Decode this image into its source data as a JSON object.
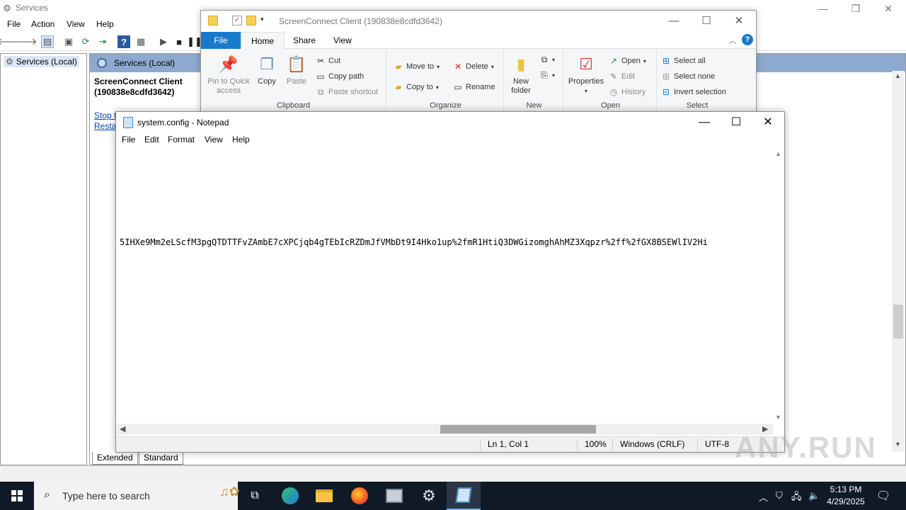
{
  "services": {
    "title": "Services",
    "menu": [
      "File",
      "Action",
      "View",
      "Help"
    ],
    "tree_item": "Services (Local)",
    "header": "Services (Local)",
    "selected_service": "ScreenConnect Client (190838e8cdfd3642)",
    "link_stop": "Stop",
    "link_stop_suffix": "t",
    "link_restart": "Restar",
    "tabs": [
      "Extended",
      "Standard"
    ]
  },
  "explorer": {
    "title": "ScreenConnect Client (190838e8cdfd3642)",
    "tabs": [
      "File",
      "Home",
      "Share",
      "View"
    ],
    "groups": {
      "clipboard": {
        "name": "Clipboard",
        "pin": "Pin to Quick access",
        "copy": "Copy",
        "paste": "Paste",
        "cut": "Cut",
        "copy_path": "Copy path",
        "paste_shortcut": "Paste shortcut"
      },
      "organize": {
        "name": "Organize",
        "move_to": "Move to",
        "copy_to": "Copy to",
        "delete": "Delete",
        "rename": "Rename"
      },
      "new": {
        "name": "New",
        "new_folder": "New folder"
      },
      "open": {
        "name": "Open",
        "properties": "Properties",
        "open": "Open",
        "edit": "Edit",
        "history": "History"
      },
      "select": {
        "name": "Select",
        "select_all": "Select all",
        "select_none": "Select none",
        "invert": "Invert selection"
      }
    }
  },
  "notepad": {
    "title": "system.config - Notepad",
    "menu": [
      "File",
      "Edit",
      "Format",
      "View",
      "Help"
    ],
    "content": "5IHXe9Mm2eLScfM3pgQTDTTFvZAmbE7cXPCjqb4gTEbIcRZDmJfVMbDt9I4Hko1up%2fmR1HtiQ3DWGizomghAhMZ3Xqpzr%2ff%2fGX8BSEWlIV2Hi",
    "status": {
      "position": "Ln 1, Col 1",
      "zoom": "100%",
      "line_endings": "Windows (CRLF)",
      "encoding": "UTF-8"
    }
  },
  "watermark": "ANY.RUN",
  "taskbar": {
    "search_placeholder": "Type here to search",
    "time": "5:13 PM",
    "date": "4/29/2025"
  },
  "colors": {
    "accent": "#1979ca",
    "taskbar": "#101a27",
    "services_header": "#8da9cf"
  }
}
